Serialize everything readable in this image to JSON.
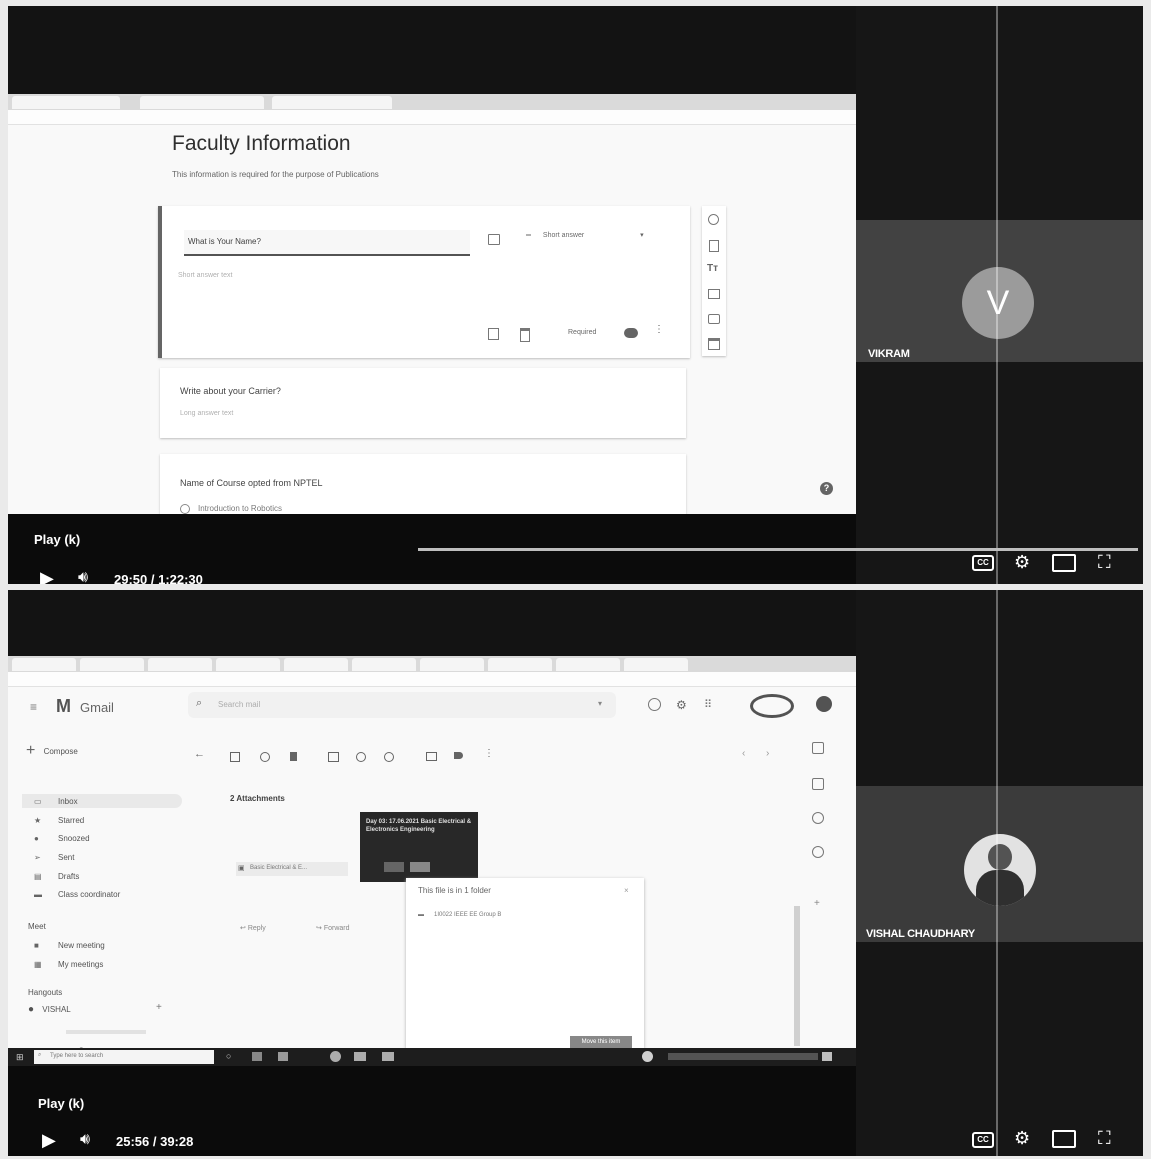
{
  "video1": {
    "play_label": "Play (k)",
    "time": "29:50 / 1:22:30",
    "participant": {
      "initial": "V",
      "name": "VIKRAM"
    },
    "form": {
      "title": "Faculty Information",
      "description": "This information is required for the purpose of Publications",
      "q1": {
        "text": "What is Your Name?",
        "type": "Short answer",
        "placeholder": "Short answer text",
        "required_label": "Required"
      },
      "q2": {
        "text": "Write about your Carrier?",
        "placeholder": "Long answer text"
      },
      "q3": {
        "text": "Name of Course opted from NPTEL",
        "option1": "Introduction to Robotics"
      },
      "toolbar_text_icon": "Tт"
    }
  },
  "video2": {
    "play_label": "Play (k)",
    "time": "25:56 / 39:28",
    "participant": {
      "name": "VISHAL CHAUDHARY"
    },
    "gmail": {
      "logo": "Gmail",
      "search_placeholder": "Search mail",
      "compose": "Compose",
      "nav": [
        "Inbox",
        "Starred",
        "Snoozed",
        "Sent",
        "Drafts",
        "Class coordinator"
      ],
      "meet_header": "Meet",
      "meet_items": [
        "New meeting",
        "My meetings"
      ],
      "hangouts_header": "Hangouts",
      "hangouts_user": "VISHAL",
      "attachments_label": "2 Attachments",
      "attachment_file": "Basic Electrical & E...",
      "thumb_title": "Day 03: 17.06.2021 Basic Electrical & Electronics Engineering",
      "folder_label": "This file is in 1 folder",
      "folder_item": "1I0022 IEEE EE Group B",
      "reply": "Reply",
      "forward": "Forward",
      "move_button": "Move this item",
      "taskbar_search": "Type here to search"
    }
  }
}
